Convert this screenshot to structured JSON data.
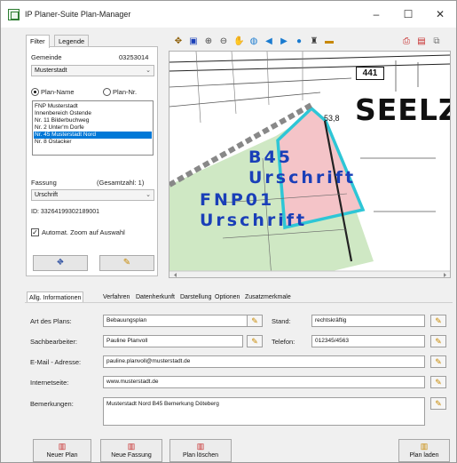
{
  "window": {
    "title": "IP Planer-Suite Plan-Manager",
    "minimize": "–",
    "maximize": "☐",
    "close": "✕"
  },
  "left_tabs": [
    {
      "label": "Filter",
      "active": true
    },
    {
      "label": "Legende",
      "active": false
    }
  ],
  "filter": {
    "gemeinde_label": "Gemeinde",
    "gemeinde_code": "03253014",
    "gemeinde_value": "Musterstadt",
    "radio_planname": "Plan-Name",
    "radio_plannr": "Plan-Nr.",
    "plans": [
      {
        "label": "FNP Musterstadt",
        "selected": false
      },
      {
        "label": "Innenbereich Ostende",
        "selected": false
      },
      {
        "label": "Nr. 11 Bilderbuchweg",
        "selected": false
      },
      {
        "label": "Nr. 2 Unter'm Dorfe",
        "selected": false
      },
      {
        "label": "Nr. 45 Musterstadt Nord",
        "selected": true
      },
      {
        "label": "Nr. 8 Ostacker",
        "selected": false
      }
    ],
    "fassung_label": "Fassung",
    "gesamtzahl": "(Gesamtzahl: 1)",
    "fassung_value": "Urschrift",
    "id_text": "ID: 33264199302189001",
    "auto_zoom_label": "Automat. Zoom auf Auswahl",
    "auto_zoom_checked": true
  },
  "toolbar_icons": [
    "move-icon",
    "save-icon",
    "zoom-in-icon",
    "zoom-out-icon",
    "pan-icon",
    "globe-icon",
    "back-icon",
    "forward-icon",
    "info-icon",
    "binoculars-icon",
    "ruler-icon",
    "print-icon",
    "export-icon",
    "copy-icon"
  ],
  "map": {
    "road_number": "441",
    "town": "SEELZ",
    "elevation": "53,8",
    "label_b45": "B45",
    "label_urschrift1": "Urschrift",
    "label_fnp": "FNP01",
    "label_urschrift2": "Urschrift",
    "colors": {
      "green_area": "#cfe8c4",
      "red_area": "#f4c4c8",
      "outline": "#2ec6d6",
      "text": "#1a3fb8"
    }
  },
  "bottom_tabs": [
    {
      "label": "Allg. Informationen",
      "active": true
    },
    {
      "label": "Verfahren",
      "active": false
    },
    {
      "label": "Datenherkunft",
      "active": false
    },
    {
      "label": "Darstellung",
      "active": false
    },
    {
      "label": "Optionen",
      "active": false
    },
    {
      "label": "Zusatzmerkmale",
      "active": false
    }
  ],
  "info": {
    "art_label": "Art des Plans:",
    "art_value": "Bebauungsplan",
    "stand_label": "Stand:",
    "stand_value": "rechtskräftig",
    "sach_label": "Sachbearbeiter:",
    "sach_value": "Pauline Planvoll",
    "tel_label": "Telefon:",
    "tel_value": "012345/4563",
    "email_label": "E-Mail - Adresse:",
    "email_value": "pauline.planvoll@musterstadt.de",
    "web_label": "Internetseite:",
    "web_value": "www.musterstadt.de",
    "bem_label": "Bemerkungen:",
    "bem_value": "Musterstadt Nord B45 Bemerkung Döteberg"
  },
  "bottom_buttons": {
    "neuer_plan": "Neuer Plan",
    "neue_fassung": "Neue Fassung",
    "plan_loeschen": "Plan löschen",
    "plan_laden": "Plan laden"
  }
}
